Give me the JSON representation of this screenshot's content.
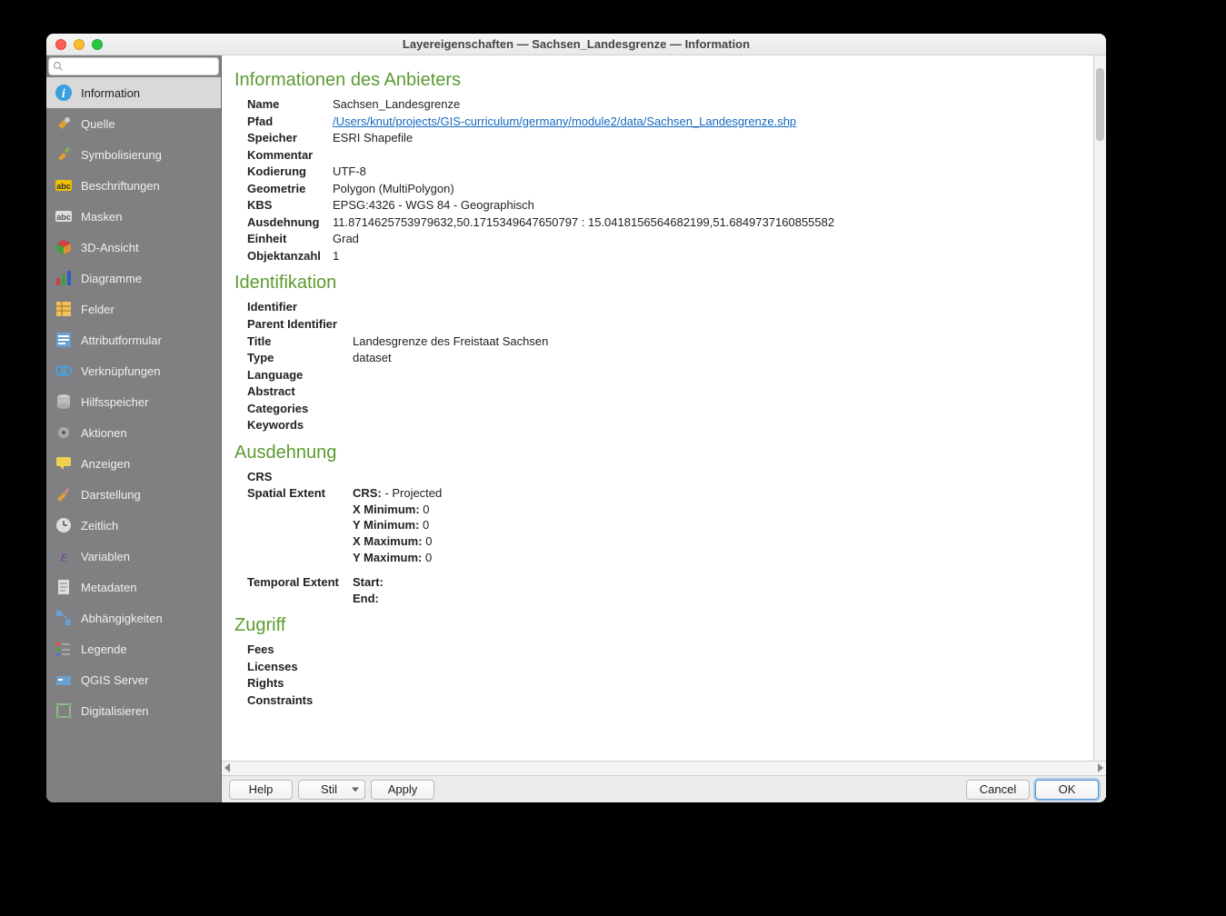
{
  "window": {
    "title": "Layereigenschaften — Sachsen_Landesgrenze — Information"
  },
  "sidebar": {
    "search_placeholder": "",
    "items": [
      {
        "label": "Information",
        "active": true
      },
      {
        "label": "Quelle"
      },
      {
        "label": "Symbolisierung"
      },
      {
        "label": "Beschriftungen"
      },
      {
        "label": "Masken"
      },
      {
        "label": "3D-Ansicht"
      },
      {
        "label": "Diagramme"
      },
      {
        "label": "Felder"
      },
      {
        "label": "Attributformular"
      },
      {
        "label": "Verknüpfungen"
      },
      {
        "label": "Hilfsspeicher"
      },
      {
        "label": "Aktionen"
      },
      {
        "label": "Anzeigen"
      },
      {
        "label": "Darstellung"
      },
      {
        "label": "Zeitlich"
      },
      {
        "label": "Variablen"
      },
      {
        "label": "Metadaten"
      },
      {
        "label": "Abhängigkeiten"
      },
      {
        "label": "Legende"
      },
      {
        "label": "QGIS Server"
      },
      {
        "label": "Digitalisieren"
      }
    ]
  },
  "sections": {
    "provider": {
      "heading": "Informationen des Anbieters",
      "rows": {
        "name_k": "Name",
        "name_v": "Sachsen_Landesgrenze",
        "path_k": "Pfad",
        "path_v": "/Users/knut/projects/GIS-curriculum/germany/module2/data/Sachsen_Landesgrenze.shp",
        "storage_k": "Speicher",
        "storage_v": "ESRI Shapefile",
        "comment_k": "Kommentar",
        "comment_v": "",
        "encoding_k": "Kodierung",
        "encoding_v": "UTF-8",
        "geom_k": "Geometrie",
        "geom_v": "Polygon (MultiPolygon)",
        "crs_k": "KBS",
        "crs_v": "EPSG:4326 - WGS 84 - Geographisch",
        "extent_k": "Ausdehnung",
        "extent_v": "11.8714625753979632,50.1715349647650797 : 15.0418156564682199,51.6849737160855582",
        "unit_k": "Einheit",
        "unit_v": "Grad",
        "count_k": "Objektanzahl",
        "count_v": "1"
      }
    },
    "ident": {
      "heading": "Identifikation",
      "rows": {
        "identifier_k": "Identifier",
        "identifier_v": "",
        "parent_k": "Parent Identifier",
        "parent_v": "",
        "title_k": "Title",
        "title_v": "Landesgrenze des Freistaat Sachsen",
        "type_k": "Type",
        "type_v": "dataset",
        "lang_k": "Language",
        "lang_v": "",
        "abstract_k": "Abstract",
        "abstract_v": "",
        "cat_k": "Categories",
        "cat_v": "",
        "kw_k": "Keywords",
        "kw_v": ""
      }
    },
    "extent": {
      "heading": "Ausdehnung",
      "crs_k": "CRS",
      "crs_v": "",
      "spatial_k": "Spatial Extent",
      "spatial": {
        "crs_label": "CRS:",
        "crs_val": " - Projected",
        "xmin_label": "X Minimum:",
        "xmin_val": " 0",
        "ymin_label": "Y Minimum:",
        "ymin_val": " 0",
        "xmax_label": "X Maximum:",
        "xmax_val": " 0",
        "ymax_label": "Y Maximum:",
        "ymax_val": " 0"
      },
      "temporal_k": "Temporal Extent",
      "temporal": {
        "start_label": "Start:",
        "start_val": "",
        "end_label": "End:",
        "end_val": ""
      }
    },
    "access": {
      "heading": "Zugriff",
      "rows": {
        "fees_k": "Fees",
        "fees_v": "",
        "lic_k": "Licenses",
        "lic_v": "",
        "rights_k": "Rights",
        "rights_v": "",
        "con_k": "Constraints",
        "con_v": ""
      }
    }
  },
  "footer": {
    "help": "Help",
    "style": "Stil",
    "apply": "Apply",
    "cancel": "Cancel",
    "ok": "OK"
  },
  "icons": {
    "info": "#3aa0e0",
    "quelle": "#e0a030",
    "symbol": "#e0a030",
    "label": "#f0b000",
    "mask": "#bbb",
    "3d": "#c02020",
    "dia": "#2060c0",
    "fields": "#f0b000",
    "form": "#6aa0d0",
    "join": "#3aa0e0",
    "aux": "#ccc",
    "act": "#888",
    "tip": "#f0d050",
    "render": "#e0a030",
    "time": "#ddd",
    "var": "#7040a0",
    "meta": "#ddd",
    "dep": "#6aa0d0",
    "leg": "#e05050",
    "srv": "#6aa0d0",
    "dig": "#9c9"
  }
}
